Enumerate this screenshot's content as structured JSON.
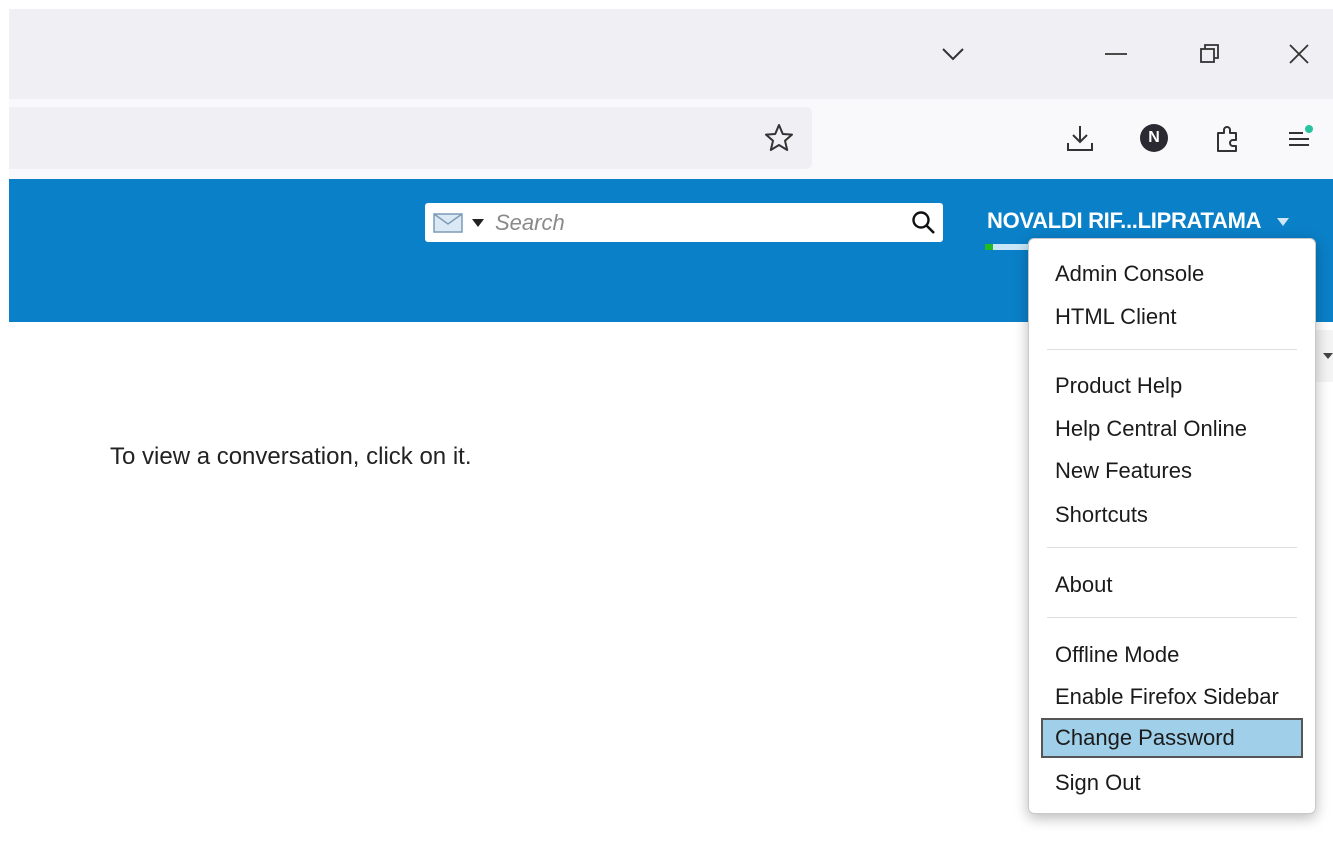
{
  "browser": {
    "window_controls": {
      "tab_list": "chevron-down-icon",
      "minimize": "minimize-icon",
      "restore": "restore-icon",
      "close": "close-icon"
    },
    "toolbar_icons": [
      "star-icon",
      "download-icon",
      "profile-icon",
      "extensions-icon",
      "menu-icon"
    ],
    "profile_initial": "N"
  },
  "app": {
    "search": {
      "placeholder": "Search",
      "type_icon": "envelope-icon"
    },
    "user": {
      "name": "NOVALDI RIF...LIPRATAMA"
    },
    "quota_fraction": 0.15,
    "main": {
      "message": "To view a conversation, click on it."
    },
    "accent": "#0a80c8"
  },
  "menu": {
    "groups": [
      {
        "items": [
          "Admin Console",
          "HTML Client"
        ]
      },
      {
        "items": [
          "Product Help",
          "Help Central Online",
          "New Features",
          "Shortcuts"
        ]
      },
      {
        "items": [
          "About"
        ]
      },
      {
        "items": [
          "Offline Mode",
          "Enable Firefox Sidebar",
          "Change Password",
          "Sign Out"
        ]
      }
    ],
    "selected": "Change Password"
  }
}
